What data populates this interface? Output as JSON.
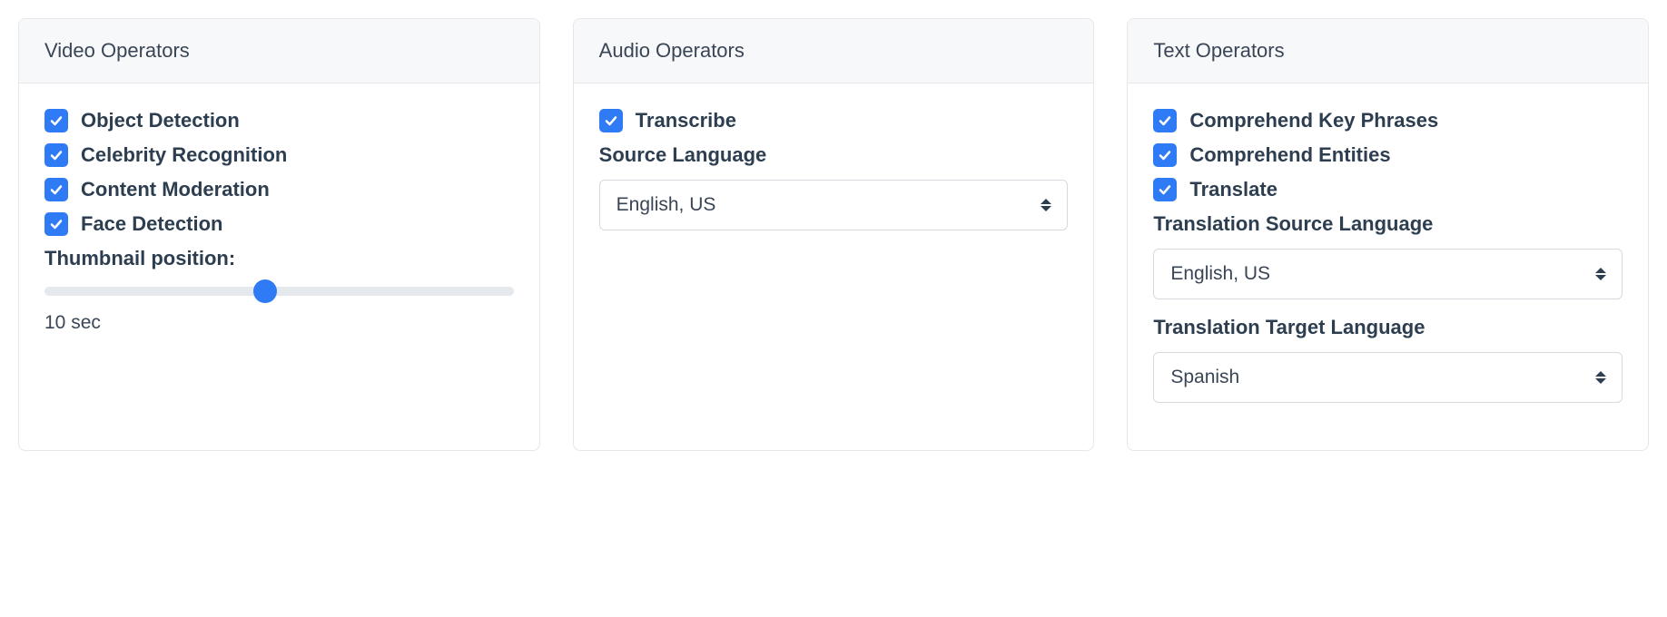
{
  "video": {
    "title": "Video Operators",
    "options": {
      "object_detection": "Object Detection",
      "celebrity_recognition": "Celebrity Recognition",
      "content_moderation": "Content Moderation",
      "face_detection": "Face Detection"
    },
    "thumbnail_label": "Thumbnail position:",
    "thumbnail_value": "10 sec",
    "thumbnail_percent": 47
  },
  "audio": {
    "title": "Audio Operators",
    "options": {
      "transcribe": "Transcribe"
    },
    "source_language_label": "Source Language",
    "source_language_value": "English, US"
  },
  "text": {
    "title": "Text Operators",
    "options": {
      "comprehend_key_phrases": "Comprehend Key Phrases",
      "comprehend_entities": "Comprehend Entities",
      "translate": "Translate"
    },
    "translation_source_label": "Translation Source Language",
    "translation_source_value": "English, US",
    "translation_target_label": "Translation Target Language",
    "translation_target_value": "Spanish"
  }
}
